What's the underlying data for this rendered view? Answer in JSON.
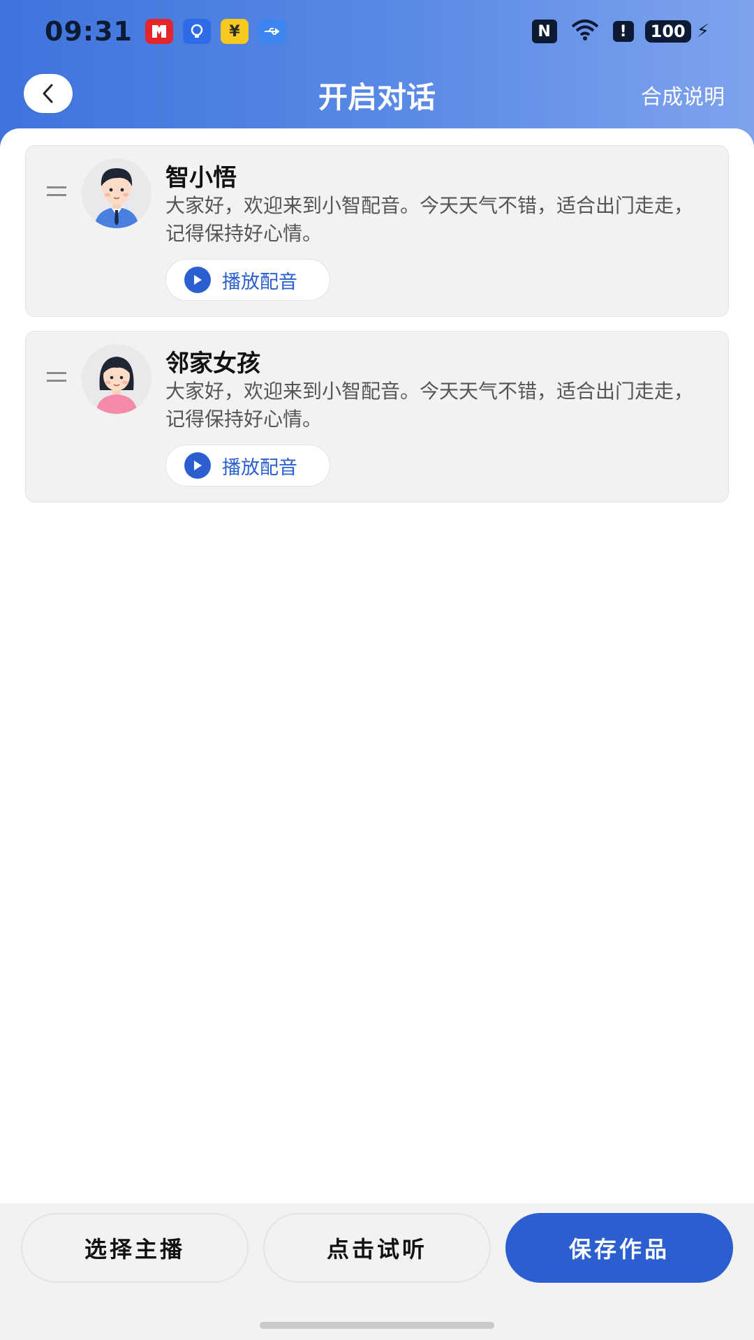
{
  "status_bar": {
    "time": "09:31",
    "notif_icons": [
      "cmb-bank-icon",
      "bulb-app-icon",
      "yuan-app-icon",
      "usb-icon"
    ],
    "nfc": "N",
    "battery": "100"
  },
  "header": {
    "title": "开启对话",
    "help_link": "合成说明"
  },
  "dialogues": [
    {
      "speaker": "智小悟",
      "avatar": "male-avatar",
      "text": "大家好，欢迎来到小智配音。今天天气不错，适合出门走走，记得保持好心情。",
      "play_label": "播放配音"
    },
    {
      "speaker": "邻家女孩",
      "avatar": "female-avatar",
      "text": "大家好，欢迎来到小智配音。今天天气不错，适合出门走走，记得保持好心情。",
      "play_label": "播放配音"
    }
  ],
  "bottom_bar": {
    "choose_anchor": "选择主播",
    "preview": "点击试听",
    "save": "保存作品"
  },
  "colors": {
    "accent": "#2b5fd0",
    "header_gradient_start": "#3f74dd",
    "header_gradient_end": "#7ea3ec"
  }
}
